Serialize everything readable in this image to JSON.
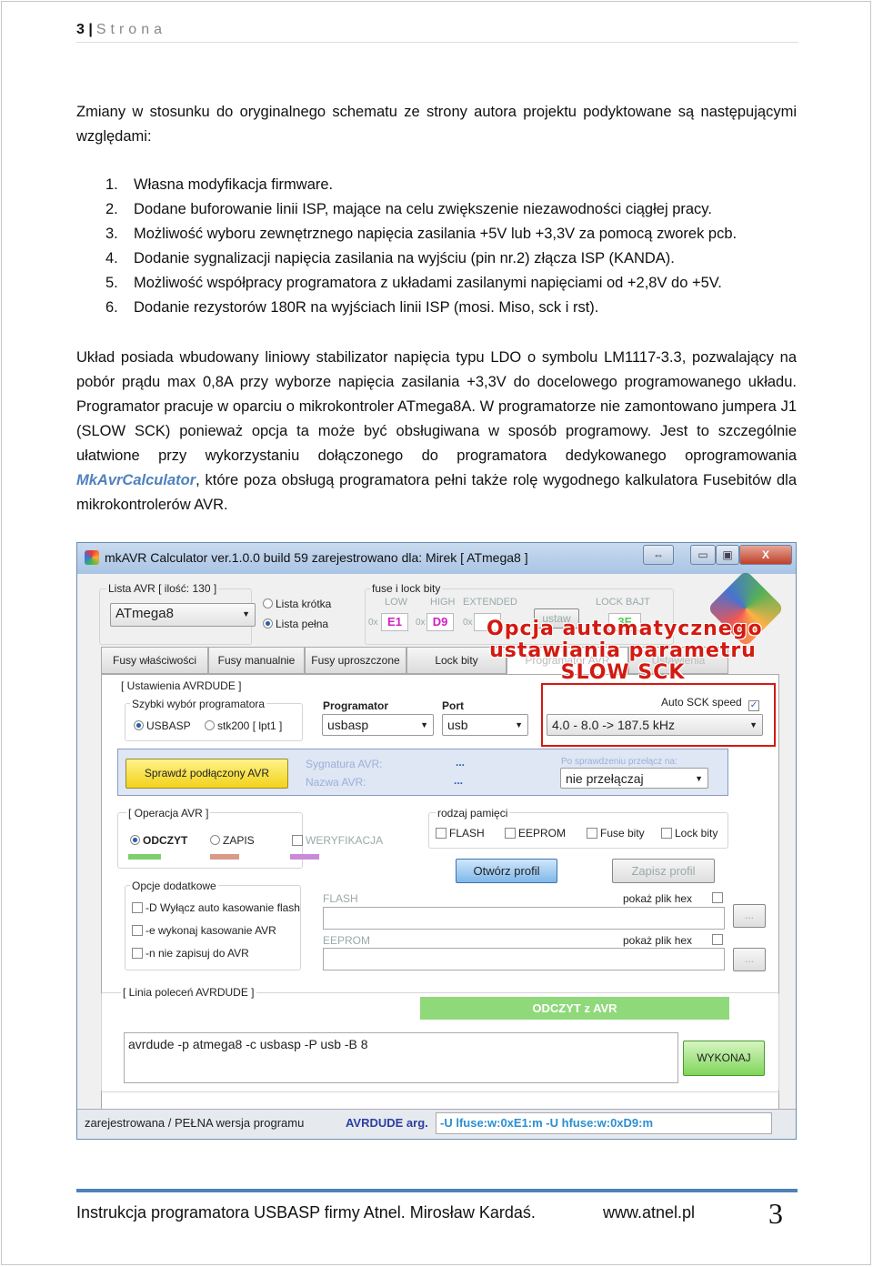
{
  "header": {
    "page_num": "3",
    "separator": "|",
    "label": "Strona"
  },
  "intro": "Zmiany w stosunku do oryginalnego schematu ze strony autora projektu podyktowane są następującymi względami:",
  "list": [
    {
      "n": "1.",
      "t": "Własna modyfikacja firmware."
    },
    {
      "n": "2.",
      "t": "Dodane buforowanie linii ISP, mające na celu zwiększenie niezawodności ciągłej pracy."
    },
    {
      "n": "3.",
      "t": "Możliwość wyboru zewnętrznego napięcia zasilania +5V lub +3,3V za pomocą zworek pcb."
    },
    {
      "n": "4.",
      "t": "Dodanie sygnalizacji napięcia zasilania na wyjściu (pin nr.2) złącza ISP (KANDA)."
    },
    {
      "n": "5.",
      "t": "Możliwość współpracy programatora z układami zasilanymi napięciami od +2,8V do +5V."
    },
    {
      "n": "6.",
      "t": "Dodanie rezystorów 180R na wyjściach linii ISP (mosi. Miso, sck i rst)."
    }
  ],
  "para2": {
    "before": "Układ posiada wbudowany liniowy stabilizator napięcia typu LDO o symbolu LM1117-3.3, pozwalający na pobór prądu max 0,8A przy wyborze napięcia zasilania +3,3V do docelowego programowanego układu. Programator pracuje w oparciu o mikrokontroler ATmega8A. W programatorze nie zamontowano jumpera J1 (SLOW SCK) ponieważ opcja ta może być obsługiwana w sposób programowy. Jest to szczególnie ułatwione przy wykorzystaniu dołączonego do programatora dedykowanego oprogramowania ",
    "link": "MkAvrCalculator",
    "after": ", które poza obsługą programatora pełni także rolę wygodnego kalkulatora Fusebitów dla mikrokontrolerów AVR."
  },
  "app": {
    "title": "mkAVR Calculator ver.1.0.0 build 59  zarejestrowano dla: Mirek    [ ATmega8 ]",
    "window_buttons": {
      "swap": "⇔",
      "min": "▭",
      "max": "▣",
      "close": "X"
    },
    "lista_avr": {
      "label": "Lista AVR [ ilość: 130 ]",
      "value": "ATmega8",
      "short": "Lista krótka",
      "full": "Lista pełna",
      "selected": "Lista pełna"
    },
    "fuse": {
      "label": "fuse i lock bity",
      "low_label": "LOW",
      "low": "E1",
      "high_label": "HIGH",
      "high": "D9",
      "ext_label": "EXTENDED",
      "ext": "",
      "prefix": "0x",
      "set": "ustaw",
      "lock_label": "LOCK BAJT",
      "lock": "3F"
    },
    "overlay": [
      "Opcja automatycznego",
      "ustawiania parametru",
      "SLOW SCK"
    ],
    "tabs": [
      "Fusy właściwości",
      "Fusy manualnie",
      "Fusy uproszczone",
      "Lock bity",
      "Programator AVR",
      "Ustawienia"
    ],
    "active_tab": "Programator AVR",
    "avrdude": {
      "label": "[ Ustawienia AVRDUDE ]",
      "quick_label": "Szybki wybór programatora",
      "usbasp": "USBASP",
      "stk200": "stk200 [ lpt1 ]",
      "prog_label": "Programator",
      "prog": "usbasp",
      "port_label": "Port",
      "port": "usb",
      "auto_sck": "Auto SCK speed",
      "auto_sck_checked": true,
      "sck": "4.0 - 8.0 -> 187.5 kHz"
    },
    "check": {
      "button": "Sprawdź podłączony AVR",
      "sig_label": "Sygnatura AVR:",
      "sig": "...",
      "name_label": "Nazwa AVR:",
      "name": "...",
      "after_label": "Po sprawdzeniu przełącz na:",
      "after": "nie przełączaj"
    },
    "operation": {
      "label": "[ Operacja AVR ]",
      "read": "ODCZYT",
      "write": "ZAPIS",
      "verify": "WERYFIKACJA",
      "colors": {
        "read": "#7ccf6a",
        "write": "#d99a88",
        "verify": "#c98ad8"
      }
    },
    "memory": {
      "label": "rodzaj pamięci",
      "items": [
        "FLASH",
        "EEPROM",
        "Fuse bity",
        "Lock bity"
      ]
    },
    "open_profile": "Otwórz profil",
    "save_profile": "Zapisz profil",
    "extra": {
      "label": "Opcje dodatkowe",
      "items": [
        "-D Wyłącz auto kasowanie flash",
        "-e wykonaj kasowanie AVR",
        "-n nie zapisuj do AVR"
      ]
    },
    "flash_label": "FLASH",
    "eeprom_label": "EEPROM",
    "show_hex": "pokaż plik hex",
    "browse": "...",
    "cmd": {
      "label": "[ Linia poleceń AVRDUDE ]",
      "action": "ODCZYT z AVR",
      "value": "avrdude -p atmega8 -c usbasp -P usb  -B 8",
      "run": "WYKONAJ"
    },
    "status": {
      "left": "zarejestrowana / PEŁNA wersja programu",
      "args_label": "AVRDUDE arg.",
      "args": "-U lfuse:w:0xE1:m  -U hfuse:w:0xD9:m"
    }
  },
  "footer": {
    "text": "Instrukcja programatora USBASP firmy Atnel. Mirosław Kardaś.",
    "url": "www.atnel.pl",
    "page": "3"
  }
}
